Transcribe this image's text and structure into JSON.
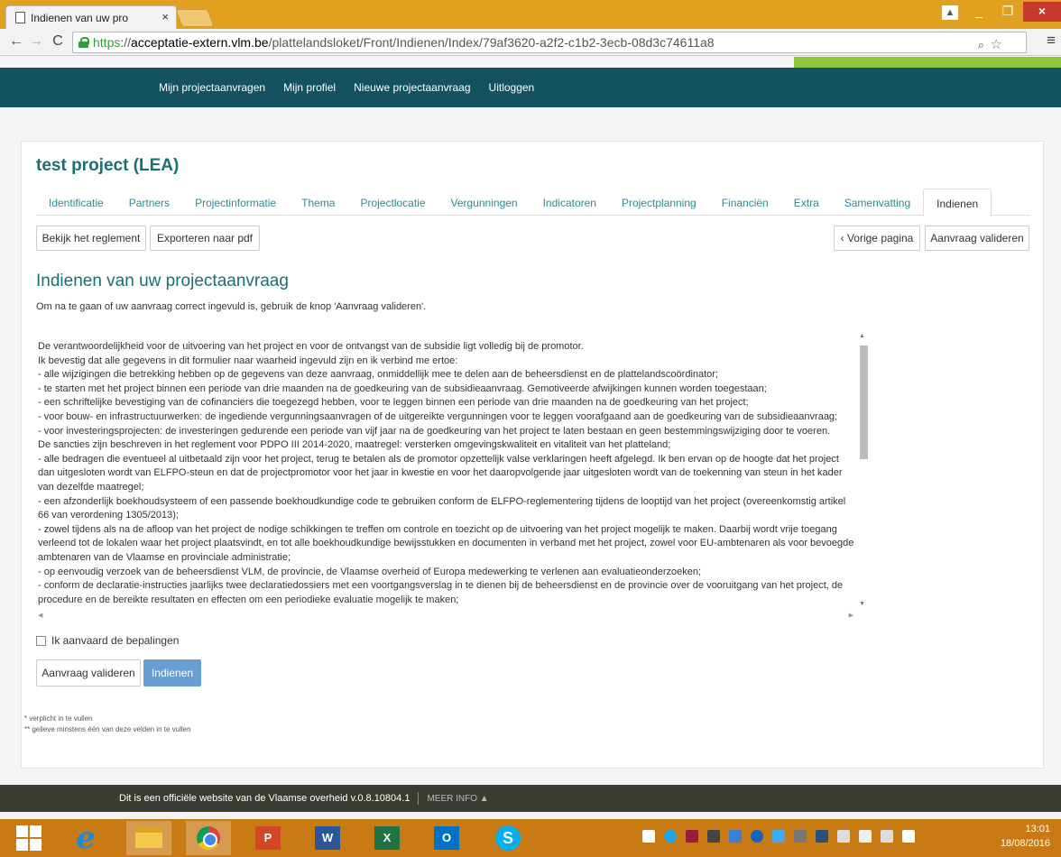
{
  "browser": {
    "tab_title": "Indienen van uw pro",
    "tab_close": "×",
    "url_scheme": "https",
    "url_sep": "://",
    "url_host": "acceptatie-extern.vlm.be",
    "url_path": "/plattelandsloket/Front/Indienen/Index/79af3620-a2f2-c1b2-3ecb-08d3c74611a8",
    "window_controls": {
      "minimize": "_",
      "maximize": "❐",
      "close": "×"
    }
  },
  "topnav": {
    "items": [
      {
        "label": "Mijn projectaanvragen"
      },
      {
        "label": "Mijn profiel"
      },
      {
        "label": "Nieuwe projectaanvraag"
      },
      {
        "label": "Uitloggen"
      }
    ]
  },
  "project": {
    "title": "test project (LEA)",
    "tabs": [
      {
        "label": "Identificatie"
      },
      {
        "label": "Partners"
      },
      {
        "label": "Projectinformatie"
      },
      {
        "label": "Thema"
      },
      {
        "label": "Projectlocatie"
      },
      {
        "label": "Vergunningen"
      },
      {
        "label": "Indicatoren"
      },
      {
        "label": "Projectplanning"
      },
      {
        "label": "Financiën"
      },
      {
        "label": "Extra"
      },
      {
        "label": "Samenvatting"
      },
      {
        "label": "Indienen",
        "active": true
      }
    ]
  },
  "actions": {
    "regulation": "Bekijk het reglement",
    "export_pdf": "Exporteren naar pdf",
    "previous": "‹ Vorige pagina",
    "validate": "Aanvraag valideren"
  },
  "section": {
    "title": "Indienen van uw projectaanvraag",
    "intro": "Om na te gaan of uw aanvraag correct ingevuld is, gebruik de knop 'Aanvraag valideren'."
  },
  "declaration": {
    "lines": [
      "De verantwoordelijkheid voor de uitvoering van het project en voor de ontvangst van de subsidie ligt volledig bij de promotor.",
      "Ik bevestig dat alle gegevens in dit formulier naar waarheid ingevuld zijn en ik verbind me ertoe:",
      "- alle wijzigingen die betrekking hebben op de gegevens van deze aanvraag, onmiddellijk mee te delen aan de beheersdienst en de plattelandscoördinator;",
      "- te starten met het project binnen een periode van drie maanden na de goedkeuring van de subsidieaanvraag. Gemotiveerde afwijkingen kunnen worden toegestaan;",
      "- een schriftelijke bevestiging van de cofinanciers die toegezegd hebben, voor te leggen binnen een periode van drie maanden na de goedkeuring van het project;",
      "- voor bouw- en infrastructuurwerken: de ingediende vergunningsaanvragen of de uitgereikte vergunningen voor te leggen voorafgaand aan de goedkeuring van de subsidieaanvraag;",
      "- voor investeringsprojecten: de investeringen gedurende een periode van vijf jaar na de goedkeuring van het project te laten bestaan en geen bestemmingswijziging door te voeren.",
      "De sancties zijn beschreven in het reglement voor PDPO III 2014-2020, maatregel: versterken omgevingskwaliteit en vitaliteit van het platteland;",
      "- alle bedragen die eventueel al uitbetaald zijn voor het project, terug te betalen als de promotor opzettelijk valse verklaringen heeft afgelegd. Ik ben ervan op de hoogte dat het project dan uitgesloten wordt van ELFPO-steun en dat de projectpromotor voor het jaar in kwestie en voor het daaropvolgende jaar uitgesloten wordt van de toekenning van steun in het kader van dezelfde maatregel;",
      "- een afzonderlijk boekhoudsysteem of een passende boekhoudkundige code te gebruiken conform de ELFPO-reglementering tijdens de looptijd van het project (overeenkomstig artikel 66 van verordening 1305/2013);",
      "- zowel tijdens als na de afloop van het project de nodige schikkingen te treffen om controle en toezicht op de uitvoering van het project mogelijk te maken. Daarbij wordt vrije toegang verleend tot de lokalen waar het project plaatsvindt, en tot alle boekhoudkundige bewijsstukken en documenten in verband met het project, zowel voor EU-ambtenaren als voor bevoegde ambtenaren van de Vlaamse en provinciale administratie;",
      "- op eenvoudig verzoek van de beheersdienst VLM, de provincie, de Vlaamse overheid of Europa medewerking te verlenen aan evaluatieonderzoeken;",
      "- conform de declaratie-instructies jaarlijks twee declaratiedossiers met een voortgangsverslag in te dienen bij de beheersdienst en de provincie over de vooruitgang van het project, de procedure en de bereikte resultaten en effecten om een periodieke evaluatie mogelijk te maken;"
    ]
  },
  "form": {
    "accept_label": "Ik aanvaard de bepalingen",
    "accept_checked": false,
    "validate": "Aanvraag valideren",
    "submit": "Indienen",
    "note_required": "* verplicht in te vullen",
    "note_atleast": "** gelieve minstens één van deze velden in te vullen"
  },
  "footer": {
    "text": "Dit is een officiële website van de Vlaamse overheid v.0.8.10804.1",
    "more": "MEER INFO ▲"
  },
  "taskbar": {
    "time": "13:01",
    "date": "18/08/2016",
    "ppt_label": "P",
    "word_label": "W",
    "excel_label": "X",
    "outlook_label": "O",
    "skype_label": "S",
    "ie_label": "e"
  },
  "colors": {
    "nav_bg": "#15525f",
    "accent_teal": "#1a6e74",
    "link": "#2a8a93",
    "submit_bg": "#6a9ed3",
    "footer_bg": "#3b3b33",
    "green_strip": "#8dc63f",
    "taskbar_bg": "#c87a14"
  }
}
